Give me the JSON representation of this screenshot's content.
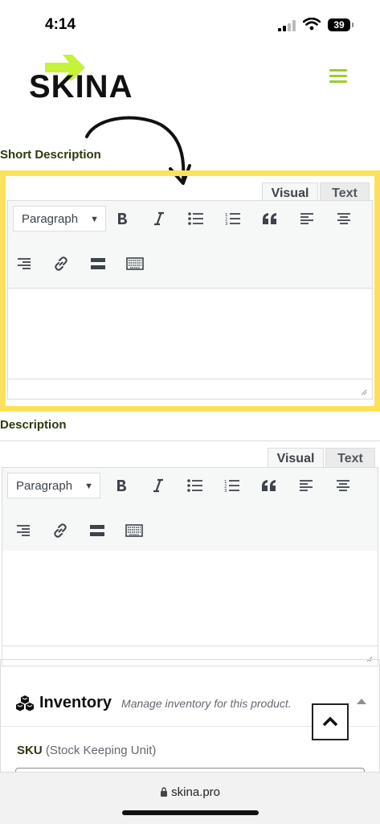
{
  "status_bar": {
    "time": "4:14",
    "battery": "39"
  },
  "brand": {
    "logo_text": "SKINA",
    "accent_color": "#c6f23a",
    "menu_color": "#9ccc2c"
  },
  "short_description": {
    "label": "Short Description",
    "tabs": [
      "Visual",
      "Text"
    ],
    "format_select": "Paragraph"
  },
  "description": {
    "label": "Description",
    "tabs": [
      "Visual",
      "Text"
    ],
    "format_select": "Paragraph"
  },
  "toolbar_icons": [
    "bold-icon",
    "italic-icon",
    "bullet-list-icon",
    "numbered-list-icon",
    "blockquote-icon",
    "align-left-icon",
    "align-center-icon",
    "align-right-icon",
    "link-icon",
    "read-more-icon",
    "toolbar-toggle-icon"
  ],
  "highlight_color": "#fde15a",
  "inventory": {
    "title": "Inventory",
    "description": "Manage inventory for this product.",
    "sku_label": "SKU",
    "sku_hint": "(Stock Keeping Unit)"
  },
  "browser": {
    "url": "skina.pro"
  }
}
